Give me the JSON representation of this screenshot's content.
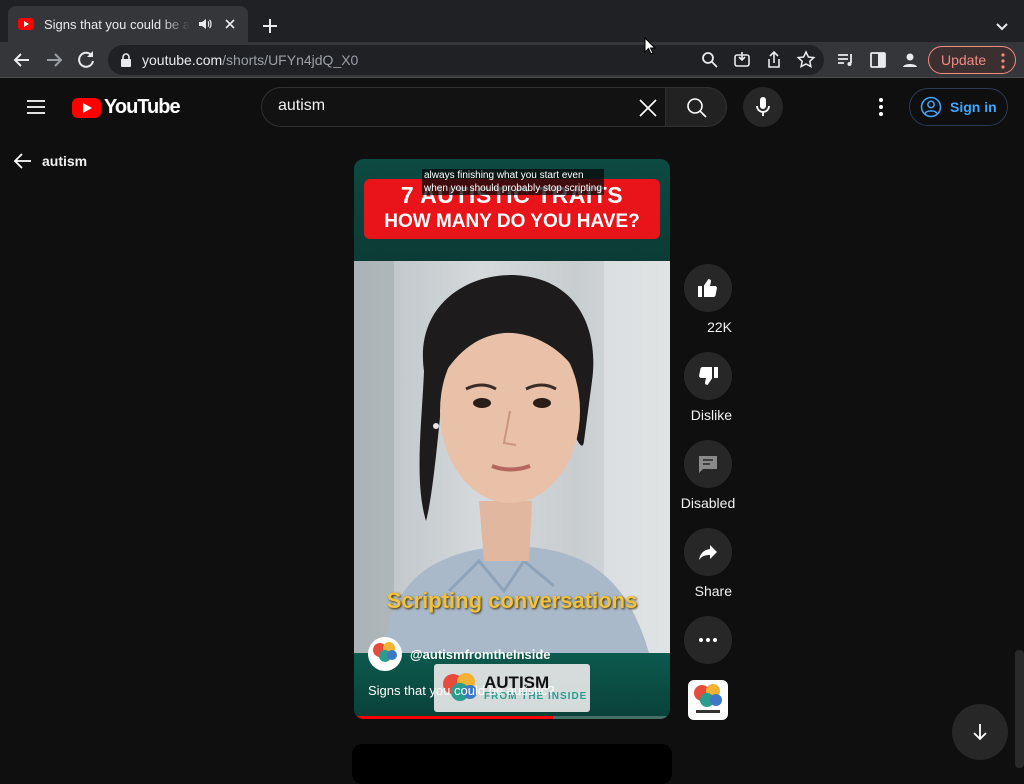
{
  "browser": {
    "tab_title": "Signs that you could be autistic?",
    "url_host": "youtube.com",
    "url_path": "/shorts/UFYn4jdQ_X0",
    "update_label": "Update"
  },
  "youtube": {
    "logo_text": "YouTube",
    "search": {
      "value": "autism",
      "placeholder": "Search"
    },
    "signin_label": "Sign in"
  },
  "back": {
    "label": "autism"
  },
  "short": {
    "caption_lines": [
      "always finishing what you start even",
      "when you should probably stop scripting"
    ],
    "banner_line1": "7 AUTISTIC TRAITS",
    "banner_line2": "HOW MANY DO YOU HAVE?",
    "overlay_text": "Scripting conversations",
    "brand_title": "AUTISM",
    "brand_subtitle": "FROM THE INSIDE",
    "channel": "@autismfromtheInside",
    "title": "Signs that you could be autistic?",
    "progress": 0.63
  },
  "actions": {
    "like": "22K",
    "dislike": "Dislike",
    "comments": "Disabled",
    "share": "Share"
  },
  "colors": {
    "brand_red": "#ff0000",
    "link_blue": "#3ea6ff",
    "banner_red": "#e9131a",
    "overlay_yellow": "#f0c23f"
  }
}
